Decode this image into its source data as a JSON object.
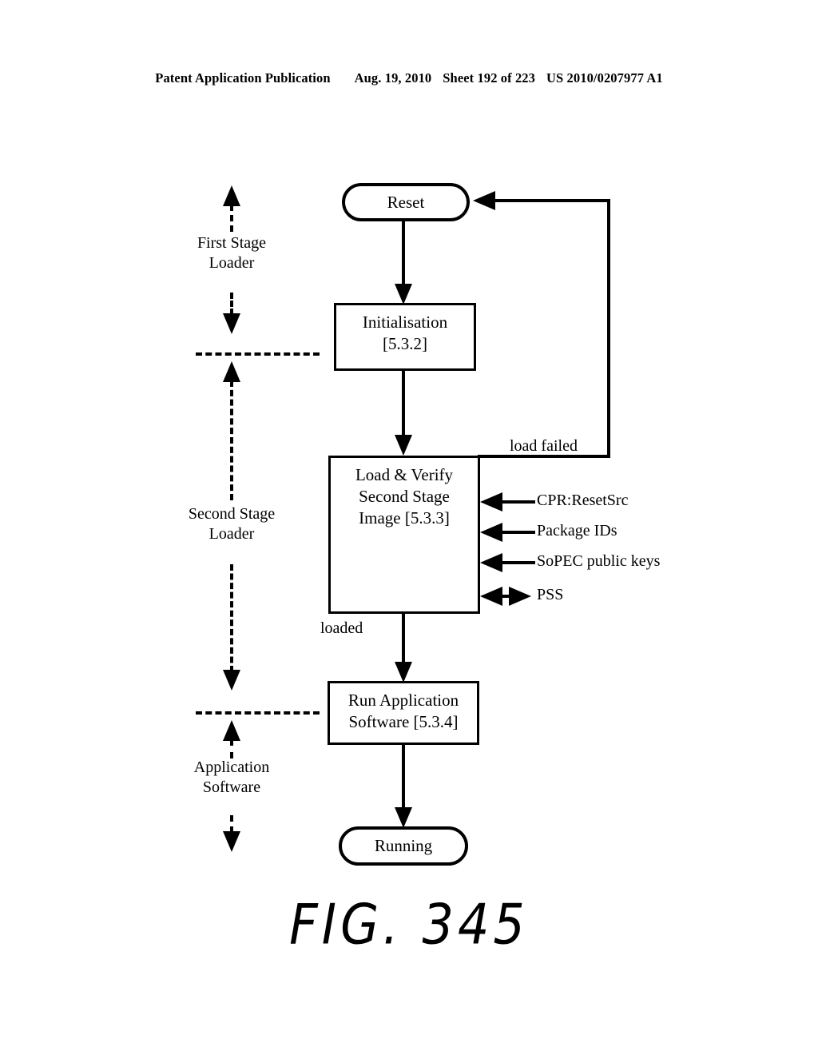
{
  "header": {
    "publication": "Patent Application Publication",
    "date": "Aug. 19, 2010",
    "sheet": "Sheet 192 of 223",
    "patent_number": "US 2010/0207977 A1"
  },
  "figure": {
    "caption": "FIG. 345"
  },
  "nodes": {
    "reset": {
      "label": "Reset"
    },
    "initialisation": {
      "line1": "Initialisation",
      "line2": "[5.3.2]"
    },
    "load_verify": {
      "line1": "Load & Verify",
      "line2": "Second Stage",
      "line3": "Image [5.3.3]"
    },
    "run_application": {
      "line1": "Run Application",
      "line2": "Software [5.3.4]"
    },
    "running": {
      "label": "Running"
    }
  },
  "edge_labels": {
    "load_failed": "load failed",
    "loaded": "loaded"
  },
  "inputs": [
    {
      "label": "CPR:ResetSrc",
      "direction": "in"
    },
    {
      "label": "Package IDs",
      "direction": "in"
    },
    {
      "label": "SoPEC public keys",
      "direction": "in"
    },
    {
      "label": "PSS",
      "direction": "bidirectional"
    }
  ],
  "stages": [
    {
      "line1": "First  Stage",
      "line2": "Loader"
    },
    {
      "line1": "Second Stage",
      "line2": "Loader"
    },
    {
      "line1": "Application",
      "line2": "Software"
    }
  ],
  "colors": {
    "ink": "#000000",
    "paper": "#ffffff"
  }
}
